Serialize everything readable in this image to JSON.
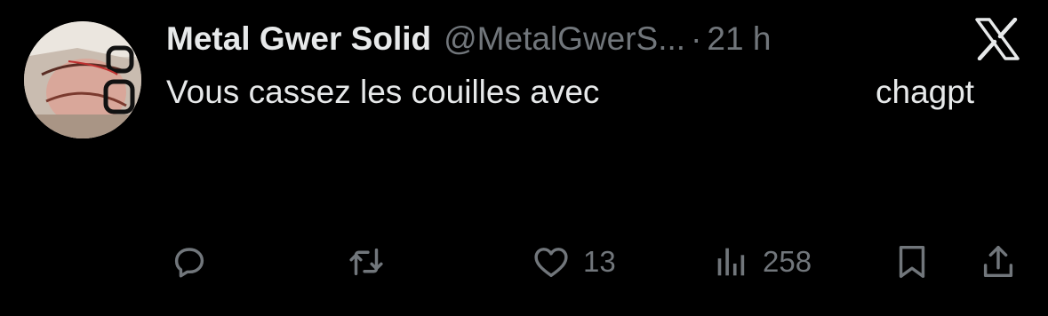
{
  "tweet": {
    "author": {
      "display_name": "Metal Gwer Solid",
      "handle": "@MetalGwerS...",
      "separator": "·",
      "timestamp": "21 h"
    },
    "text_start": "Vous cassez les couilles avec",
    "text_end": "chagpt"
  },
  "actions": {
    "reply": {
      "icon": "reply-icon"
    },
    "repost": {
      "icon": "repost-icon"
    },
    "like": {
      "icon": "heart-icon",
      "count": "13"
    },
    "views": {
      "icon": "views-chart-icon",
      "count": "258"
    },
    "bookmark": {
      "icon": "bookmark-icon"
    },
    "share": {
      "icon": "share-icon"
    }
  },
  "branding": {
    "logo": "x-logo-icon"
  },
  "colors": {
    "background": "#000000",
    "primary_text": "#e7e9ea",
    "secondary_text": "#71767b"
  }
}
